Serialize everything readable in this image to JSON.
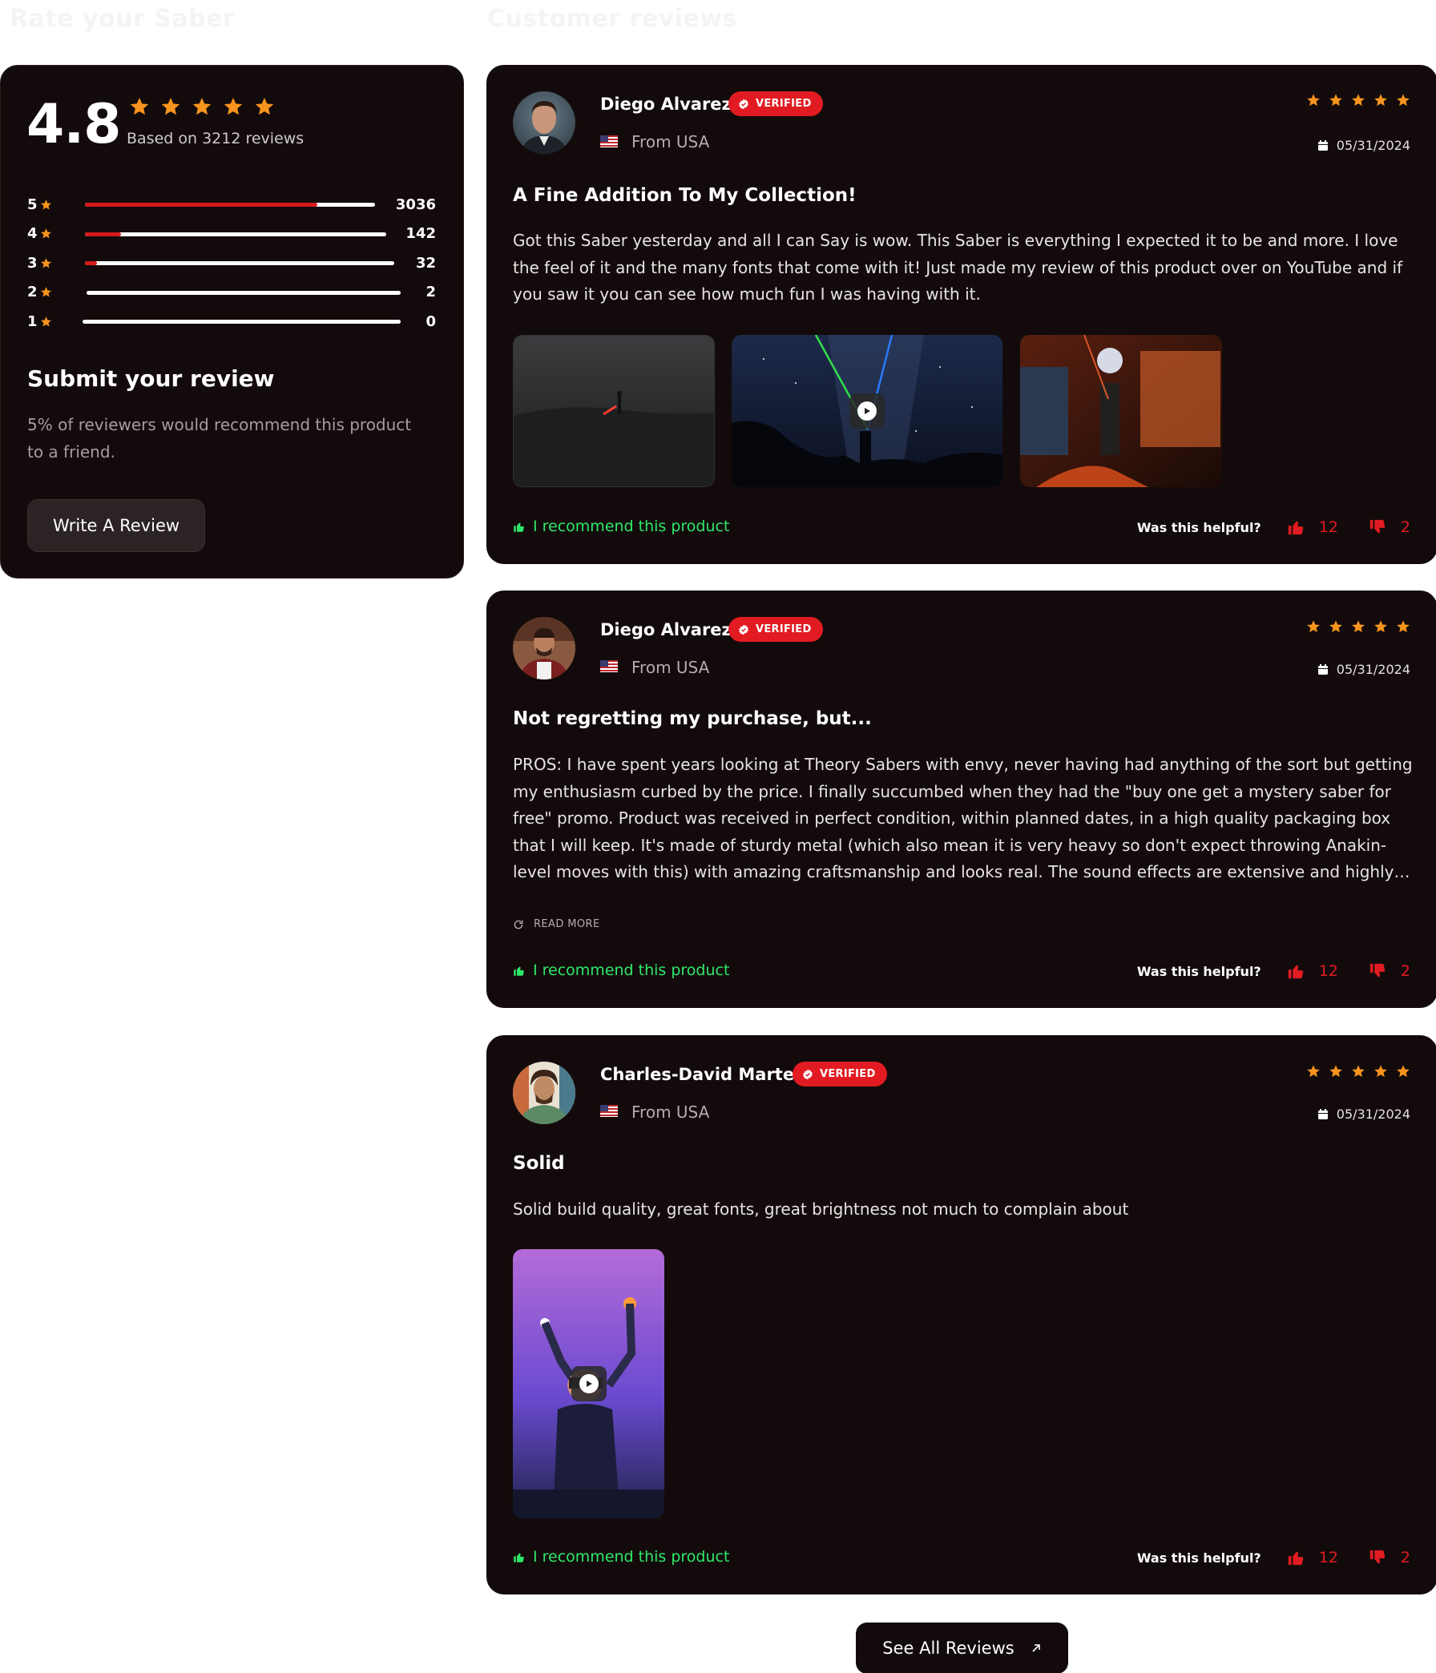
{
  "headings": {
    "left": "Rate your Saber",
    "right": "Customer reviews"
  },
  "summary": {
    "score": "4.8",
    "stars": 5,
    "based_on": "Based on 3212 reviews",
    "distribution": [
      {
        "star": "5",
        "count": "3036",
        "fraction": 0.8
      },
      {
        "star": "4",
        "count": "142",
        "fraction": 0.12
      },
      {
        "star": "3",
        "count": "32",
        "fraction": 0.04
      },
      {
        "star": "2",
        "count": "2",
        "fraction": 0.0
      },
      {
        "star": "1",
        "count": "0",
        "fraction": 0.0
      }
    ],
    "submit_title": "Submit your review",
    "submit_text": "5% of reviewers would recommend this product to a friend.",
    "write_button": "Write A Review"
  },
  "reviews": [
    {
      "name": "Diego Alvarez",
      "verified": "VERIFIED",
      "from": "From USA",
      "stars": 5,
      "date": "05/31/2024",
      "title": "A Fine Addition To My Collection!",
      "body": "Got this Saber yesterday and all I can Say is wow. This Saber is everything I expected it to be and more. I love the feel of it and the many fonts that come with it! Just made my review of this product over on YouTube and if you saw it you can see how much fun I was having with it.",
      "recommend": "I recommend this product",
      "helpful_label": "Was this helpful?",
      "likes": "12",
      "dislikes": "2"
    },
    {
      "name": "Diego Alvarez",
      "verified": "VERIFIED",
      "from": "From USA",
      "stars": 5,
      "date": "05/31/2024",
      "title": "Not regretting my purchase, but...",
      "body": "PROS: I have spent years looking at Theory Sabers with envy, never having had anything of the sort but getting my enthusiasm curbed by the price. I finally succumbed when they had the \"buy one get a mystery saber for free\" promo. Product was received in perfect condition, within planned dates, in a high quality packaging box that I will keep. It's made of sturdy metal (which also mean it is very heavy so don't expect throwing Anakin-level moves with this) with amazing craftsmanship and looks real. The sound effects are extensive and highly customizable.",
      "read_more": "READ MORE",
      "recommend": "I recommend this product",
      "helpful_label": "Was this helpful?",
      "likes": "12",
      "dislikes": "2"
    },
    {
      "name": "Charles-David Martel",
      "verified": "VERIFIED",
      "from": "From USA",
      "stars": 5,
      "date": "05/31/2024",
      "title": "Solid",
      "body": "Solid build quality, great fonts, great brightness not much to complain about",
      "recommend": "I recommend this product",
      "helpful_label": "Was this helpful?",
      "likes": "12",
      "dislikes": "2"
    }
  ],
  "see_all": "See All Reviews",
  "colors": {
    "card_bg": "#130b0b",
    "star": "#f7941d",
    "accent_red": "#e21b22",
    "recommend_green": "#2ee86b"
  }
}
